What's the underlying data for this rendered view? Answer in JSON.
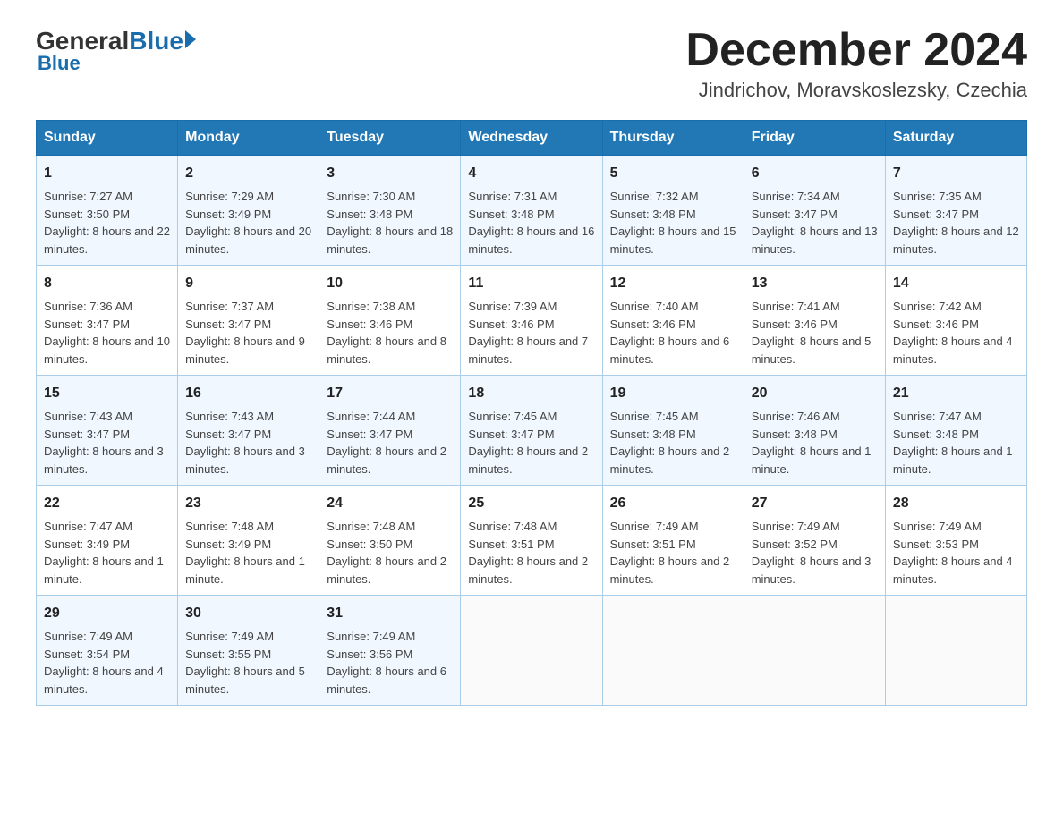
{
  "header": {
    "logo_general": "General",
    "logo_blue": "Blue",
    "month_title": "December 2024",
    "location": "Jindrichov, Moravskoslezsky, Czechia"
  },
  "days_of_week": [
    "Sunday",
    "Monday",
    "Tuesday",
    "Wednesday",
    "Thursday",
    "Friday",
    "Saturday"
  ],
  "weeks": [
    [
      {
        "day": "1",
        "sunrise": "7:27 AM",
        "sunset": "3:50 PM",
        "daylight": "8 hours and 22 minutes."
      },
      {
        "day": "2",
        "sunrise": "7:29 AM",
        "sunset": "3:49 PM",
        "daylight": "8 hours and 20 minutes."
      },
      {
        "day": "3",
        "sunrise": "7:30 AM",
        "sunset": "3:48 PM",
        "daylight": "8 hours and 18 minutes."
      },
      {
        "day": "4",
        "sunrise": "7:31 AM",
        "sunset": "3:48 PM",
        "daylight": "8 hours and 16 minutes."
      },
      {
        "day": "5",
        "sunrise": "7:32 AM",
        "sunset": "3:48 PM",
        "daylight": "8 hours and 15 minutes."
      },
      {
        "day": "6",
        "sunrise": "7:34 AM",
        "sunset": "3:47 PM",
        "daylight": "8 hours and 13 minutes."
      },
      {
        "day": "7",
        "sunrise": "7:35 AM",
        "sunset": "3:47 PM",
        "daylight": "8 hours and 12 minutes."
      }
    ],
    [
      {
        "day": "8",
        "sunrise": "7:36 AM",
        "sunset": "3:47 PM",
        "daylight": "8 hours and 10 minutes."
      },
      {
        "day": "9",
        "sunrise": "7:37 AM",
        "sunset": "3:47 PM",
        "daylight": "8 hours and 9 minutes."
      },
      {
        "day": "10",
        "sunrise": "7:38 AM",
        "sunset": "3:46 PM",
        "daylight": "8 hours and 8 minutes."
      },
      {
        "day": "11",
        "sunrise": "7:39 AM",
        "sunset": "3:46 PM",
        "daylight": "8 hours and 7 minutes."
      },
      {
        "day": "12",
        "sunrise": "7:40 AM",
        "sunset": "3:46 PM",
        "daylight": "8 hours and 6 minutes."
      },
      {
        "day": "13",
        "sunrise": "7:41 AM",
        "sunset": "3:46 PM",
        "daylight": "8 hours and 5 minutes."
      },
      {
        "day": "14",
        "sunrise": "7:42 AM",
        "sunset": "3:46 PM",
        "daylight": "8 hours and 4 minutes."
      }
    ],
    [
      {
        "day": "15",
        "sunrise": "7:43 AM",
        "sunset": "3:47 PM",
        "daylight": "8 hours and 3 minutes."
      },
      {
        "day": "16",
        "sunrise": "7:43 AM",
        "sunset": "3:47 PM",
        "daylight": "8 hours and 3 minutes."
      },
      {
        "day": "17",
        "sunrise": "7:44 AM",
        "sunset": "3:47 PM",
        "daylight": "8 hours and 2 minutes."
      },
      {
        "day": "18",
        "sunrise": "7:45 AM",
        "sunset": "3:47 PM",
        "daylight": "8 hours and 2 minutes."
      },
      {
        "day": "19",
        "sunrise": "7:45 AM",
        "sunset": "3:48 PM",
        "daylight": "8 hours and 2 minutes."
      },
      {
        "day": "20",
        "sunrise": "7:46 AM",
        "sunset": "3:48 PM",
        "daylight": "8 hours and 1 minute."
      },
      {
        "day": "21",
        "sunrise": "7:47 AM",
        "sunset": "3:48 PM",
        "daylight": "8 hours and 1 minute."
      }
    ],
    [
      {
        "day": "22",
        "sunrise": "7:47 AM",
        "sunset": "3:49 PM",
        "daylight": "8 hours and 1 minute."
      },
      {
        "day": "23",
        "sunrise": "7:48 AM",
        "sunset": "3:49 PM",
        "daylight": "8 hours and 1 minute."
      },
      {
        "day": "24",
        "sunrise": "7:48 AM",
        "sunset": "3:50 PM",
        "daylight": "8 hours and 2 minutes."
      },
      {
        "day": "25",
        "sunrise": "7:48 AM",
        "sunset": "3:51 PM",
        "daylight": "8 hours and 2 minutes."
      },
      {
        "day": "26",
        "sunrise": "7:49 AM",
        "sunset": "3:51 PM",
        "daylight": "8 hours and 2 minutes."
      },
      {
        "day": "27",
        "sunrise": "7:49 AM",
        "sunset": "3:52 PM",
        "daylight": "8 hours and 3 minutes."
      },
      {
        "day": "28",
        "sunrise": "7:49 AM",
        "sunset": "3:53 PM",
        "daylight": "8 hours and 4 minutes."
      }
    ],
    [
      {
        "day": "29",
        "sunrise": "7:49 AM",
        "sunset": "3:54 PM",
        "daylight": "8 hours and 4 minutes."
      },
      {
        "day": "30",
        "sunrise": "7:49 AM",
        "sunset": "3:55 PM",
        "daylight": "8 hours and 5 minutes."
      },
      {
        "day": "31",
        "sunrise": "7:49 AM",
        "sunset": "3:56 PM",
        "daylight": "8 hours and 6 minutes."
      },
      null,
      null,
      null,
      null
    ]
  ]
}
